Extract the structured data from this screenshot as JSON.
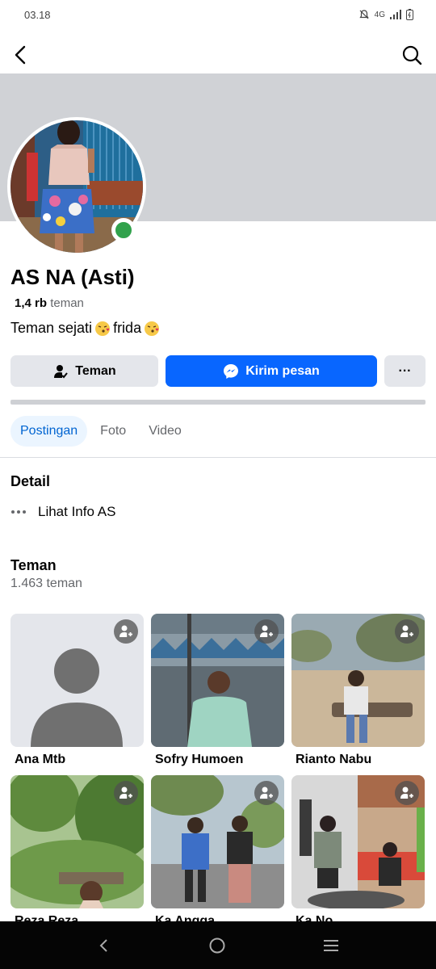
{
  "status_bar": {
    "time": "03.18",
    "network": "4G"
  },
  "profile": {
    "name": "AS NA (Asti)",
    "friend_count_short": "1,4 rb",
    "friend_count_label": "teman",
    "bio_text_1": "Teman sejati",
    "bio_text_2": "frida",
    "online": true
  },
  "actions": {
    "friend_label": "Teman",
    "message_label": "Kirim pesan",
    "more_label": "···"
  },
  "tabs": [
    {
      "label": "Postingan",
      "active": true
    },
    {
      "label": "Foto",
      "active": false
    },
    {
      "label": "Video",
      "active": false
    }
  ],
  "detail": {
    "title": "Detail",
    "info_label": "Lihat Info AS",
    "info_icon": "more-dots-icon"
  },
  "friends": {
    "title": "Teman",
    "count": "1.463 teman",
    "list": [
      {
        "name": "Ana Mtb"
      },
      {
        "name": "Sofry Humoen"
      },
      {
        "name": "Rianto Nabu"
      },
      {
        "name": "Reza Reza"
      },
      {
        "name": "Ka Angga"
      },
      {
        "name": "Ka No"
      }
    ]
  },
  "colors": {
    "primary_blue": "#0866ff",
    "online_green": "#31a24c",
    "cover_gray": "#d0d2d6",
    "button_gray": "#e4e6eb"
  }
}
